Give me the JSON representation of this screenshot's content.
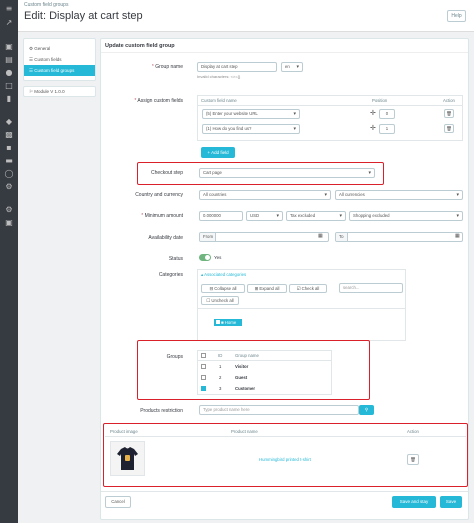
{
  "header": {
    "breadcrumb": "Custom field groups",
    "title": "Edit: Display at cart step",
    "help_label": "Help"
  },
  "subnav": {
    "items": [
      "General",
      "Custom fields",
      "Custom field groups"
    ],
    "module_version": "Module V 1.0.0"
  },
  "form": {
    "panel_title": "Update custom field group",
    "group_name": {
      "label": "Group name",
      "value": "Display at cart step",
      "lang": "en",
      "hint": "Invalid characters: <>={}"
    },
    "assign": {
      "label": "Assign custom fields",
      "col_name": "Custom field name",
      "col_position": "Position",
      "col_action": "Action",
      "rows": [
        {
          "name": "(5) Enter your website URL",
          "position": "0"
        },
        {
          "name": "(1) How do you find us?",
          "position": "1"
        }
      ],
      "add_label": "Add field"
    },
    "checkout_step": {
      "label": "Checkout step",
      "value": "Cart page"
    },
    "country_currency": {
      "label": "Country and currency",
      "country": "All countries",
      "currency": "All currencies"
    },
    "minimum_amount": {
      "label": "Minimum amount",
      "value": "0.000000",
      "currency": "USD",
      "tax": "Tax excluded",
      "shipping": "Shopping excluded"
    },
    "availability": {
      "label": "Availability date",
      "from": "From",
      "to": "To"
    },
    "status": {
      "label": "Status",
      "value": "Yes"
    },
    "categories": {
      "label": "Categories",
      "associated": "Associated categories",
      "collapse": "Collapse all",
      "expand": "Expand all",
      "check": "Check all",
      "uncheck": "Uncheck all",
      "search_placeholder": "search...",
      "home": "Home"
    },
    "groups": {
      "label": "Groups",
      "col_id": "ID",
      "col_name": "Group name",
      "rows": [
        {
          "id": "1",
          "name": "Visitor",
          "checked": false
        },
        {
          "id": "2",
          "name": "Guest",
          "checked": false
        },
        {
          "id": "3",
          "name": "Customer",
          "checked": true
        }
      ]
    },
    "products": {
      "label": "Products restriction",
      "placeholder": "Type product name here",
      "col_image": "Product image",
      "col_name": "Product name",
      "col_action": "Action",
      "product_name": "Hummingbird printed t-shirt"
    },
    "cancel_label": "Cancel",
    "save_stay_label": "Save and stay",
    "save_label": "Save"
  },
  "colors": {
    "accent": "#25b9d7",
    "highlight": "#d9202b",
    "sidebar": "#363a41",
    "toggle": "#70b580"
  },
  "icons": [
    "trend-icon",
    "basket-icon",
    "orders-icon",
    "customer-icon",
    "chat-icon",
    "stats-icon",
    "modules-icon",
    "design-icon",
    "shipping-icon",
    "payment-icon",
    "international-icon",
    "settings-icon",
    "advanced-icon"
  ]
}
